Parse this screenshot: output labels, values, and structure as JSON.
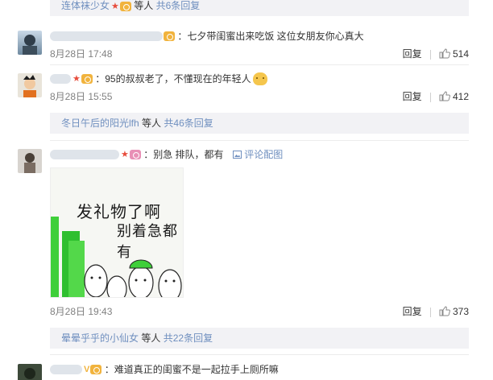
{
  "reply_bars": [
    {
      "name": "连体袜少女",
      "suffix": "等人",
      "count_label": "共6条回复"
    },
    {
      "name": "冬日午后的阳光lfh",
      "suffix": "等人",
      "count_label": "共46条回复"
    },
    {
      "name": "晕晕乎乎的小仙女",
      "suffix": "等人",
      "count_label": "共22条回复"
    }
  ],
  "comments": [
    {
      "text": "：七夕带闺蜜出来吃饭 这位女朋友你心真大",
      "time": "8月28日 17:48",
      "reply_label": "回复",
      "likes": "514"
    },
    {
      "text": "：95的叔叔老了，不懂现在的年轻人",
      "time": "8月28日 15:55",
      "reply_label": "回复",
      "likes": "412"
    },
    {
      "text": "：别急 排队，都有",
      "pic_label": "评论配图",
      "time": "8月28日 19:43",
      "reply_label": "回复",
      "likes": "373",
      "meme": {
        "line1": "发礼物了啊",
        "line2": "别着急都有"
      }
    },
    {
      "text": "：难道真正的闺蜜不是一起拉手上厕所嘛"
    }
  ],
  "colors": {
    "accent": "#eb7350",
    "link": "#6f8fbf",
    "bar_bg": "#f2f2f5",
    "time": "#808080"
  },
  "icons": {
    "like": "thumbs-up-icon",
    "pic": "image-icon",
    "star": "star-badge-icon",
    "vip": "vip-badge-icon"
  }
}
